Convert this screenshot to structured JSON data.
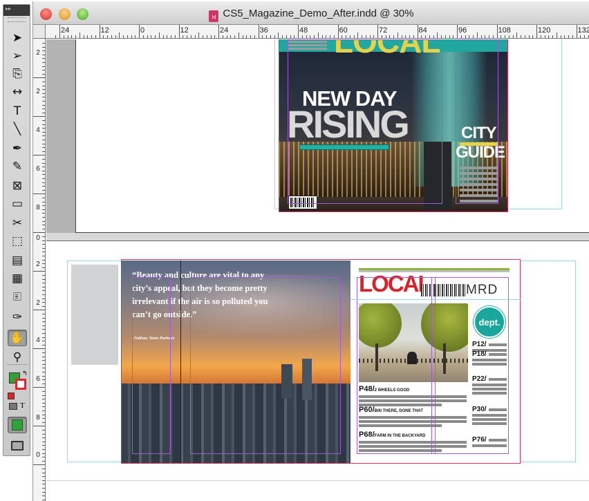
{
  "window": {
    "title": "CS5_Magazine_Demo_After.indd @ 30%",
    "doc_icon_label": "Id"
  },
  "tools": [
    {
      "name": "selection-tool",
      "glyph": "➤"
    },
    {
      "name": "direct-selection-tool",
      "glyph": "➢"
    },
    {
      "name": "page-tool",
      "glyph": "⎘"
    },
    {
      "name": "gap-tool",
      "glyph": "↔"
    },
    {
      "name": "type-tool",
      "glyph": "T"
    },
    {
      "name": "line-tool",
      "glyph": "╲"
    },
    {
      "name": "pen-tool",
      "glyph": "✒"
    },
    {
      "name": "pencil-tool",
      "glyph": "✎"
    },
    {
      "name": "rectangle-frame-tool",
      "glyph": "⊠"
    },
    {
      "name": "rectangle-tool",
      "glyph": "▭"
    },
    {
      "name": "scissors-tool",
      "glyph": "✂"
    },
    {
      "name": "free-transform-tool",
      "glyph": "⬚"
    },
    {
      "name": "gradient-swatch-tool",
      "glyph": "▤"
    },
    {
      "name": "gradient-feather-tool",
      "glyph": "▦"
    },
    {
      "name": "note-tool",
      "glyph": "🗉"
    },
    {
      "name": "eyedropper-tool",
      "glyph": "✑"
    },
    {
      "name": "hand-tool",
      "glyph": "✋"
    },
    {
      "name": "zoom-tool",
      "glyph": "⚲"
    }
  ],
  "colors": {
    "fill": "#2fa23a",
    "stroke": "#e0242a",
    "format_label": "T"
  },
  "rulers": {
    "horizontal": [
      "24",
      "12",
      "0",
      "12",
      "24",
      "36",
      "48",
      "60",
      "72",
      "84",
      "96",
      "108",
      "120",
      "132"
    ],
    "vertical": [
      "2",
      "2",
      "4",
      "6",
      "8",
      "0",
      "2",
      "2",
      "4",
      "6",
      "8",
      "0",
      "2",
      "2",
      "4",
      "6"
    ]
  },
  "cover": {
    "masthead": "LOCAL",
    "headline_1": "NEW DAY",
    "headline_2": "RISING",
    "side_1": "CITY",
    "side_2": "GUIDE"
  },
  "spread": {
    "quote": "“Beauty and culture are vital to any city’s appeal, but they become pretty irrelevant if the air is so polluted you can’t go outside.”",
    "quote_attribution": "–Nathan, Yours Partners",
    "logo": "LOCAL",
    "logo_suffix": "MRD",
    "badge": "dept.",
    "toc": [
      {
        "page": "P48/",
        "label": "2 WHEELS GOOD"
      },
      {
        "page": "P60/",
        "label": "BIN THERE, DONE THAT"
      },
      {
        "page": "P68/",
        "label": "FARM IN THE BACKYARD"
      }
    ],
    "right_pages": [
      "P12/",
      "P18/",
      "P22/",
      "P30/",
      "P76/"
    ]
  }
}
